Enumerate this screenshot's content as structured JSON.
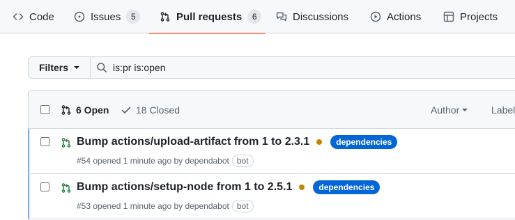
{
  "nav": {
    "tabs": [
      {
        "label": "Code",
        "icon": "code-icon"
      },
      {
        "label": "Issues",
        "count": "5",
        "icon": "issue-opened-icon"
      },
      {
        "label": "Pull requests",
        "count": "6",
        "icon": "git-pull-request-icon",
        "active": true
      },
      {
        "label": "Discussions",
        "icon": "comment-discussion-icon"
      },
      {
        "label": "Actions",
        "icon": "play-icon"
      },
      {
        "label": "Projects",
        "icon": "table-icon"
      }
    ]
  },
  "filters": {
    "button_label": "Filters",
    "search_value": "is:pr is:open"
  },
  "list_header": {
    "open_label": "6 Open",
    "closed_label": "18 Closed",
    "author_label": "Author",
    "label_label": "Label"
  },
  "pull_requests": [
    {
      "title": "Bump actions/upload-artifact from 1 to 2.3.1",
      "label": "dependencies",
      "meta": "#54 opened 1 minute ago by dependabot",
      "bot_badge": "bot"
    },
    {
      "title": "Bump actions/setup-node from 1 to 2.5.1",
      "label": "dependencies",
      "meta": "#53 opened 1 minute ago by dependabot",
      "bot_badge": "bot"
    }
  ],
  "colors": {
    "accent_underline": "#fd8c73",
    "label_bg": "#0366d6",
    "pending_dot": "#bf8700",
    "open_icon": "#1a7f37",
    "row_highlight": "#0969da"
  }
}
